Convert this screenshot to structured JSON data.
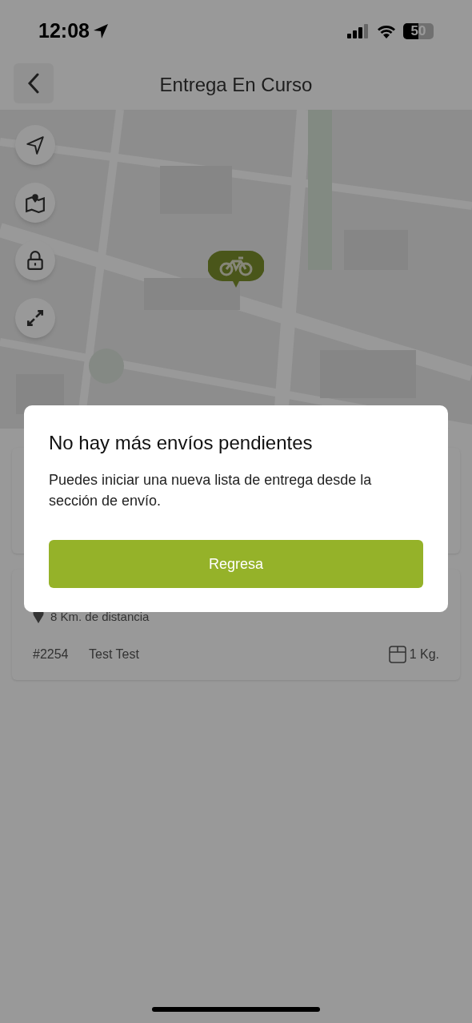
{
  "status_bar": {
    "time": "12:08",
    "battery": "50"
  },
  "header": {
    "title": "Entrega En Curso"
  },
  "cards": [
    {
      "kind": "hidden"
    },
    {
      "kind": "shipment",
      "distance": "8 Km. de distancia",
      "order": "#2254",
      "name": "Test Test",
      "weight": "1 Kg."
    }
  ],
  "dialog": {
    "title": "No hay más envíos pendientes",
    "message": "Puedes iniciar una nueva lista de entrega desde la sección de envío.",
    "button": "Regresa"
  }
}
